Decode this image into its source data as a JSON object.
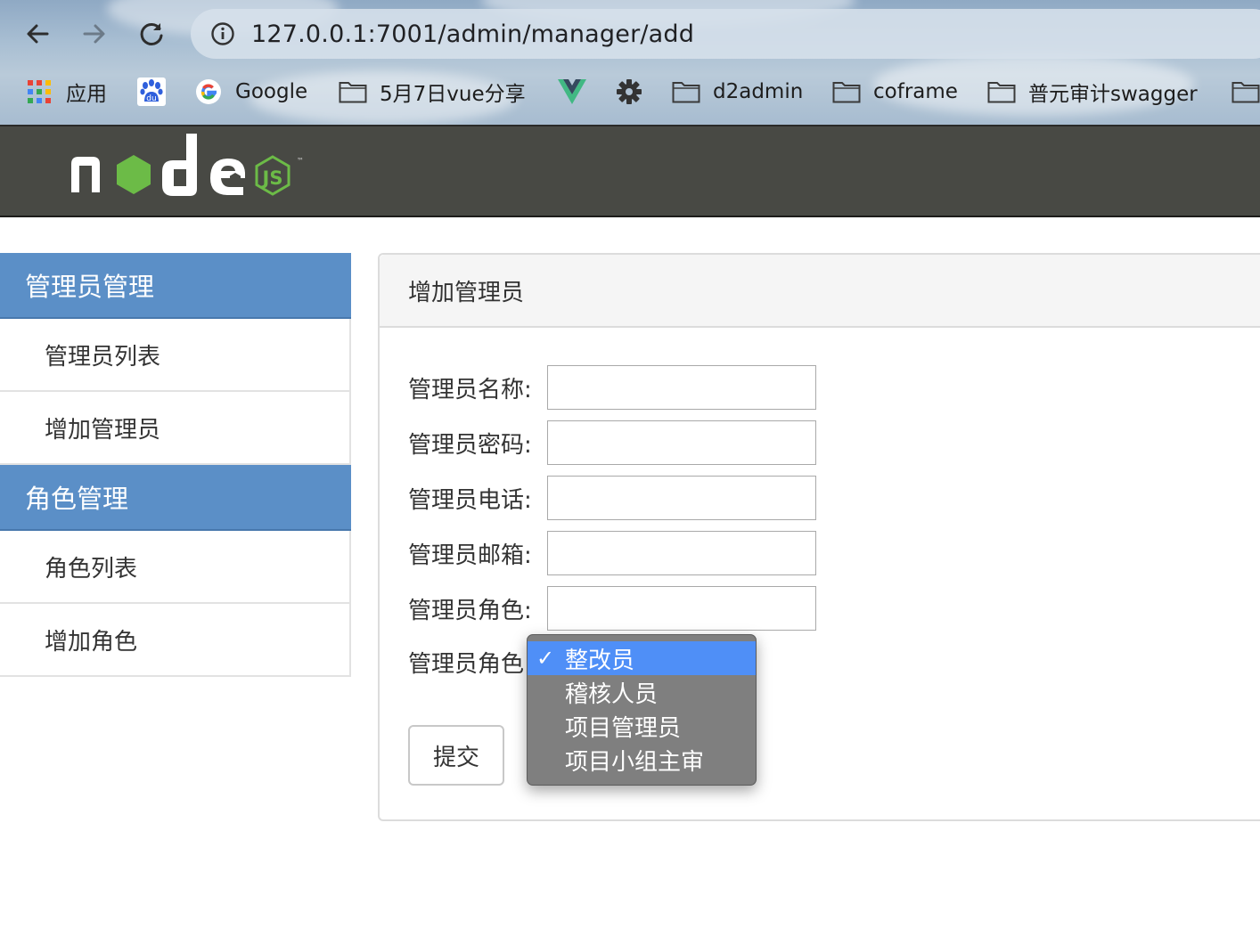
{
  "browser": {
    "url": "127.0.0.1:7001/admin/manager/add",
    "bookmarks": [
      {
        "label": "应用",
        "icon": "apps-grid-icon"
      },
      {
        "label": "",
        "icon": "baidu-paw-icon"
      },
      {
        "label": "Google",
        "icon": "google-g-icon"
      },
      {
        "label": "5月7日vue分享",
        "icon": "folder-icon"
      },
      {
        "label": "",
        "icon": "vue-logo-icon"
      },
      {
        "label": "",
        "icon": "gear-icon"
      },
      {
        "label": "d2admin",
        "icon": "folder-icon"
      },
      {
        "label": "coframe",
        "icon": "folder-icon"
      },
      {
        "label": "普元审计swagger",
        "icon": "folder-icon"
      },
      {
        "label": "",
        "icon": "folder-icon"
      }
    ]
  },
  "header": {
    "logo": "node js",
    "logo_mark": "™"
  },
  "sidebar": {
    "groups": [
      {
        "title": "管理员管理",
        "items": [
          "管理员列表",
          "增加管理员"
        ]
      },
      {
        "title": "角色管理",
        "items": [
          "角色列表",
          "增加角色"
        ]
      }
    ]
  },
  "panel": {
    "title": "增加管理员",
    "fields": [
      {
        "label": "管理员名称:",
        "value": ""
      },
      {
        "label": "管理员密码:",
        "value": ""
      },
      {
        "label": "管理员电话:",
        "value": ""
      },
      {
        "label": "管理员邮箱:",
        "value": ""
      },
      {
        "label": "管理员角色:",
        "value": ""
      }
    ],
    "select_label": "管理员角色",
    "submit_label": "提交"
  },
  "dropdown": {
    "check": "✓",
    "options": [
      "整改员",
      "稽核人员",
      "项目管理员",
      "项目小组主审"
    ],
    "selected_index": 0
  },
  "colors": {
    "sidebar_header": "#5b8fc7",
    "site_header": "#484944",
    "logo_green": "#6cbb47",
    "dropdown_bg": "#7f7f7f",
    "dropdown_selected": "#4f8ff7"
  }
}
